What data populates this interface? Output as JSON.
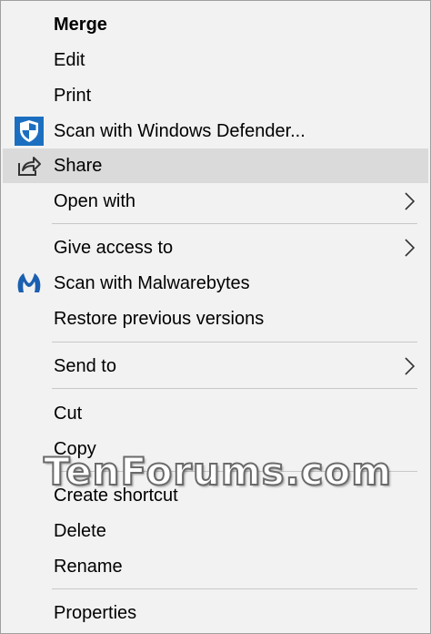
{
  "menu": {
    "items": [
      {
        "label": "Merge"
      },
      {
        "label": "Edit"
      },
      {
        "label": "Print"
      },
      {
        "label": "Scan with Windows Defender..."
      },
      {
        "label": "Share"
      },
      {
        "label": "Open with"
      },
      {
        "label": "Give access to"
      },
      {
        "label": "Scan with Malwarebytes"
      },
      {
        "label": "Restore previous versions"
      },
      {
        "label": "Send to"
      },
      {
        "label": "Cut"
      },
      {
        "label": "Copy"
      },
      {
        "label": "Create shortcut"
      },
      {
        "label": "Delete"
      },
      {
        "label": "Rename"
      },
      {
        "label": "Properties"
      }
    ],
    "highlighted_item": "Share"
  },
  "watermark": {
    "text": "TenForums.com"
  },
  "colors": {
    "menu_background": "#f2f2f2",
    "highlight": "#dadada",
    "separator": "#c8c8c8",
    "defender_blue": "#1c6fc0",
    "malwarebytes_blue": "#1b5fb0"
  },
  "icons": {
    "defender": "shield-icon",
    "share": "share-icon",
    "malwarebytes": "malwarebytes-icon",
    "submenu": "chevron-right-icon"
  }
}
